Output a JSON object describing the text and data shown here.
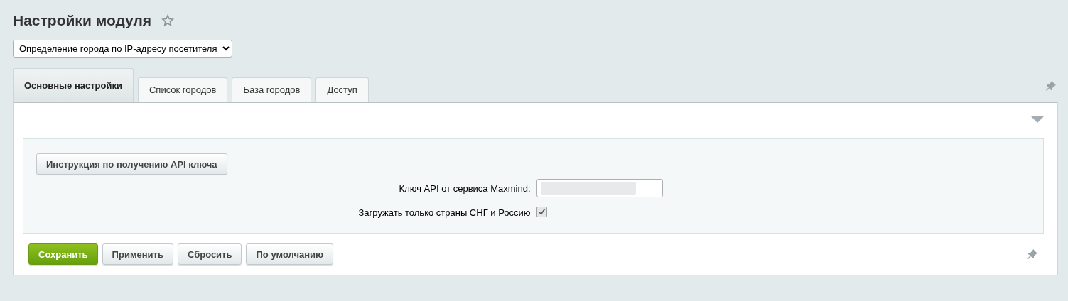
{
  "page_title": "Настройки модуля",
  "favorite": {
    "selected": false
  },
  "module_select": {
    "value": "Определение города по IP-адресу посетителя"
  },
  "tabs": [
    {
      "label": "Основные настройки",
      "selected": true
    },
    {
      "label": "Список городов",
      "selected": false
    },
    {
      "label": "База городов",
      "selected": false
    },
    {
      "label": "Доступ",
      "selected": false
    }
  ],
  "settings": {
    "instruction_button": "Инструкция по получению API ключа",
    "fields": [
      {
        "kind": "text",
        "label": "Ключ API от сервиса Maxmind:"
      },
      {
        "kind": "checkbox",
        "label": "Загружать только страны СНГ и Россию",
        "checked": true
      }
    ]
  },
  "buttons": [
    {
      "label": "Сохранить",
      "kind": "primary"
    },
    {
      "label": "Применить",
      "kind": "default"
    },
    {
      "label": "Сбросить",
      "kind": "default"
    },
    {
      "label": "По умолчанию",
      "kind": "default"
    }
  ]
}
